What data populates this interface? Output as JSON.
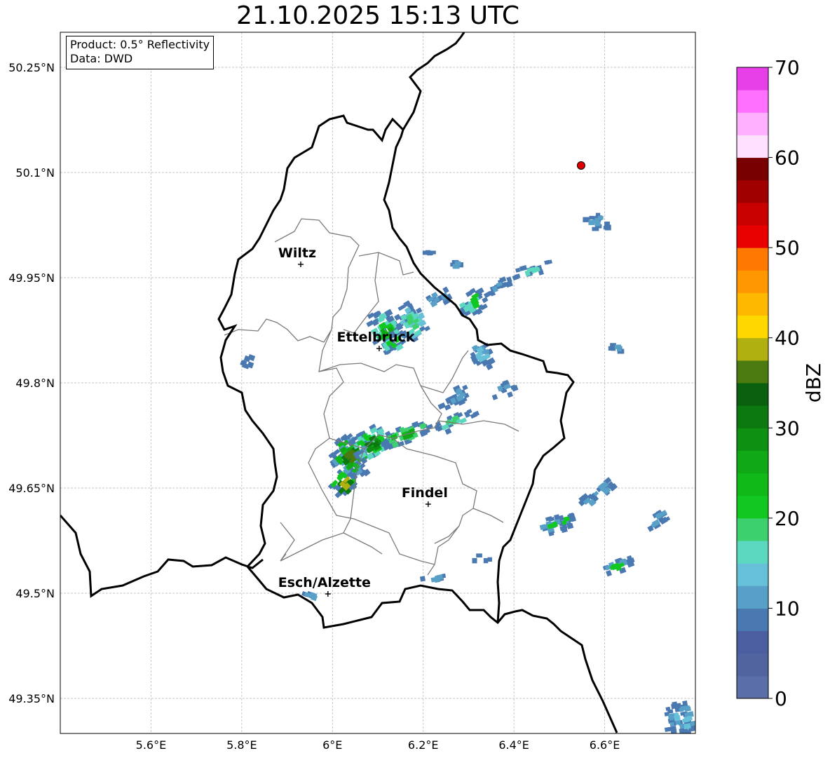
{
  "title": "21.10.2025 15:13 UTC",
  "info": {
    "product": "Product: 0.5° Reflectivity",
    "data": "Data: DWD"
  },
  "map": {
    "lon_range": [
      5.4,
      6.8
    ],
    "lat_range": [
      49.3,
      50.3
    ],
    "x_ticks": [
      {
        "value": 5.6,
        "label": "5.6°E"
      },
      {
        "value": 5.8,
        "label": "5.8°E"
      },
      {
        "value": 6.0,
        "label": "6°E"
      },
      {
        "value": 6.2,
        "label": "6.2°E"
      },
      {
        "value": 6.4,
        "label": "6.4°E"
      },
      {
        "value": 6.6,
        "label": "6.6°E"
      }
    ],
    "y_ticks": [
      {
        "value": 50.25,
        "label": "50.25°N"
      },
      {
        "value": 50.1,
        "label": "50.1°N"
      },
      {
        "value": 49.95,
        "label": "49.95°N"
      },
      {
        "value": 49.8,
        "label": "49.8°N"
      },
      {
        "value": 49.65,
        "label": "49.65°N"
      },
      {
        "value": 49.5,
        "label": "49.5°N"
      },
      {
        "value": 49.35,
        "label": "49.35°N"
      }
    ],
    "cities": [
      {
        "name": "Wiltz",
        "lon": 5.93,
        "lat": 49.969
      },
      {
        "name": "Ettelbruck",
        "lon": 6.103,
        "lat": 49.849
      },
      {
        "name": "Findel",
        "lon": 6.211,
        "lat": 49.627
      },
      {
        "name": "Esch/Alzette",
        "lon": 5.99,
        "lat": 49.499
      }
    ],
    "radar_site": {
      "lon": 6.548,
      "lat": 50.11,
      "color": "#e00000"
    }
  },
  "colorbar": {
    "title": "dBZ",
    "min": 0,
    "max": 70,
    "step": 2.5,
    "ticks": [
      0,
      10,
      20,
      30,
      40,
      50,
      60,
      70
    ],
    "colors": [
      "#5a6ea8",
      "#5264a0",
      "#4a5ea0",
      "#4a78b0",
      "#58a0c8",
      "#66c0d8",
      "#5cd8c0",
      "#3cd06e",
      "#10c820",
      "#10b818",
      "#10a814",
      "#0e9012",
      "#0c7810",
      "#0a600e",
      "#4a7a10",
      "#b0b010",
      "#ffd800",
      "#ffb800",
      "#ff9800",
      "#ff7800",
      "#e80000",
      "#c80000",
      "#a00000",
      "#780000",
      "#ffe0ff",
      "#ffb0ff",
      "#ff70ff",
      "#e840e8"
    ]
  },
  "echoes": [
    {
      "lon": 6.04,
      "lat": 49.695,
      "rlon": 0.045,
      "rlat": 0.032,
      "rot": -38,
      "colors": [
        "#4a78b0",
        "#58a0c8",
        "#10b818",
        "#10a814",
        "#0c7810",
        "#4a7a10"
      ]
    },
    {
      "lon": 6.085,
      "lat": 49.715,
      "rlon": 0.05,
      "rlat": 0.022,
      "rot": -30,
      "colors": [
        "#4a78b0",
        "#5cd8c0",
        "#10c820",
        "#0e9012",
        "#0c7810"
      ]
    },
    {
      "lon": 6.16,
      "lat": 49.725,
      "rlon": 0.06,
      "rlat": 0.012,
      "rot": -22,
      "colors": [
        "#4a78b0",
        "#3cd06e",
        "#10b818",
        "#10a814"
      ]
    },
    {
      "lon": 6.025,
      "lat": 49.655,
      "rlon": 0.03,
      "rlat": 0.02,
      "rot": -45,
      "colors": [
        "#4a78b0",
        "#10c820",
        "#0c7810",
        "#b0b010"
      ]
    },
    {
      "lon": 6.27,
      "lat": 49.745,
      "rlon": 0.05,
      "rlat": 0.01,
      "rot": -25,
      "colors": [
        "#4a78b0",
        "#5cd8c0",
        "#3cd06e"
      ]
    },
    {
      "lon": 6.38,
      "lat": 49.79,
      "rlon": 0.03,
      "rlat": 0.01,
      "rot": -20,
      "colors": [
        "#4a78b0",
        "#58a0c8"
      ]
    },
    {
      "lon": 6.12,
      "lat": 49.87,
      "rlon": 0.035,
      "rlat": 0.038,
      "rot": -30,
      "colors": [
        "#4a78b0",
        "#5cd8c0",
        "#10c820",
        "#10a814"
      ]
    },
    {
      "lon": 6.175,
      "lat": 49.885,
      "rlon": 0.03,
      "rlat": 0.03,
      "rot": -30,
      "colors": [
        "#4a78b0",
        "#66c0d8",
        "#5cd8c0",
        "#3cd06e"
      ]
    },
    {
      "lon": 6.31,
      "lat": 49.915,
      "rlon": 0.04,
      "rlat": 0.015,
      "rot": -30,
      "colors": [
        "#4a78b0",
        "#5cd8c0",
        "#10c820"
      ]
    },
    {
      "lon": 6.23,
      "lat": 49.92,
      "rlon": 0.03,
      "rlat": 0.012,
      "rot": -30,
      "colors": [
        "#4a78b0",
        "#58a0c8"
      ]
    },
    {
      "lon": 6.44,
      "lat": 49.962,
      "rlon": 0.05,
      "rlat": 0.008,
      "rot": -15,
      "colors": [
        "#4a78b0",
        "#5cd8c0"
      ]
    },
    {
      "lon": 6.373,
      "lat": 49.94,
      "rlon": 0.04,
      "rlat": 0.008,
      "rot": -20,
      "colors": [
        "#4a78b0",
        "#58a0c8"
      ]
    },
    {
      "lon": 6.585,
      "lat": 50.03,
      "rlon": 0.03,
      "rlat": 0.012,
      "rot": 0,
      "colors": [
        "#4a78b0",
        "#58a0c8"
      ]
    },
    {
      "lon": 6.625,
      "lat": 49.85,
      "rlon": 0.02,
      "rlat": 0.005,
      "rot": 0,
      "colors": [
        "#4a78b0",
        "#58a0c8"
      ]
    },
    {
      "lon": 6.328,
      "lat": 49.84,
      "rlon": 0.02,
      "rlat": 0.02,
      "rot": -30,
      "colors": [
        "#4a78b0",
        "#58a0c8",
        "#66c0d8"
      ]
    },
    {
      "lon": 6.27,
      "lat": 49.78,
      "rlon": 0.04,
      "rlat": 0.012,
      "rot": -25,
      "colors": [
        "#4a78b0",
        "#58a0c8"
      ]
    },
    {
      "lon": 6.5,
      "lat": 49.6,
      "rlon": 0.055,
      "rlat": 0.012,
      "rot": -15,
      "colors": [
        "#4a78b0",
        "#58a0c8",
        "#10c820"
      ]
    },
    {
      "lon": 6.58,
      "lat": 49.64,
      "rlon": 0.05,
      "rlat": 0.012,
      "rot": -40,
      "colors": [
        "#4a78b0",
        "#58a0c8"
      ]
    },
    {
      "lon": 6.72,
      "lat": 49.605,
      "rlon": 0.04,
      "rlat": 0.01,
      "rot": -30,
      "colors": [
        "#4a78b0",
        "#58a0c8"
      ]
    },
    {
      "lon": 6.63,
      "lat": 49.54,
      "rlon": 0.04,
      "rlat": 0.01,
      "rot": -20,
      "colors": [
        "#4a78b0",
        "#58a0c8",
        "#10c820"
      ]
    },
    {
      "lon": 6.33,
      "lat": 49.55,
      "rlon": 0.03,
      "rlat": 0.006,
      "rot": 0,
      "colors": [
        "#4a78b0"
      ]
    },
    {
      "lon": 6.22,
      "lat": 49.522,
      "rlon": 0.025,
      "rlat": 0.007,
      "rot": -10,
      "colors": [
        "#4a78b0",
        "#58a0c8"
      ]
    },
    {
      "lon": 5.95,
      "lat": 49.497,
      "rlon": 0.015,
      "rlat": 0.004,
      "rot": 20,
      "colors": [
        "#4a78b0",
        "#58a0c8"
      ]
    },
    {
      "lon": 5.81,
      "lat": 49.832,
      "rlon": 0.015,
      "rlat": 0.008,
      "rot": 20,
      "colors": [
        "#4a78b0"
      ]
    },
    {
      "lon": 6.77,
      "lat": 49.32,
      "rlon": 0.04,
      "rlat": 0.025,
      "rot": -10,
      "colors": [
        "#4a78b0",
        "#58a0c8",
        "#66c0d8"
      ]
    },
    {
      "lon": 6.27,
      "lat": 49.97,
      "rlon": 0.012,
      "rlat": 0.006,
      "rot": 0,
      "colors": [
        "#4a78b0",
        "#58a0c8"
      ]
    },
    {
      "lon": 6.21,
      "lat": 49.985,
      "rlon": 0.01,
      "rlat": 0.004,
      "rot": 0,
      "colors": [
        "#4a78b0"
      ]
    }
  ]
}
